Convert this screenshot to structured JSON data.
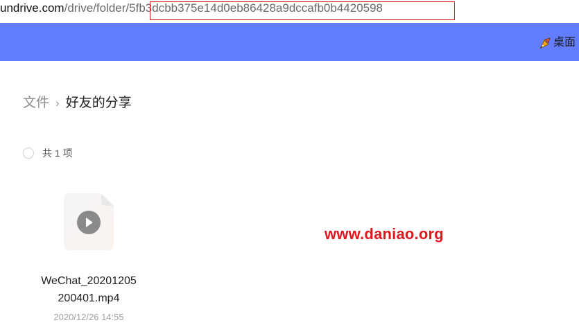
{
  "address_bar": {
    "host": "undrive.com",
    "path": "/drive/folder/",
    "folder_id": "5fb3dcbb375e14d0eb86428a9dccafb0b4420598"
  },
  "header": {
    "desktop_label": "桌面",
    "desktop_icon": "rocket-icon"
  },
  "breadcrumb": {
    "root": "文件",
    "separator": "›",
    "current": "好友的分享"
  },
  "list": {
    "count_label": "共 1 项"
  },
  "files": [
    {
      "name": "WeChat_20201205200401.mp4",
      "name_line1": "WeChat_20201205",
      "name_line2": "200401.mp4",
      "date": "2020/12/26 14:55",
      "icon": "video-file-icon"
    }
  ],
  "watermark": {
    "text": "www.daniao.org",
    "color": "#e3161e"
  },
  "colors": {
    "header_bg": "#637dff",
    "highlight_border": "#e02020"
  }
}
